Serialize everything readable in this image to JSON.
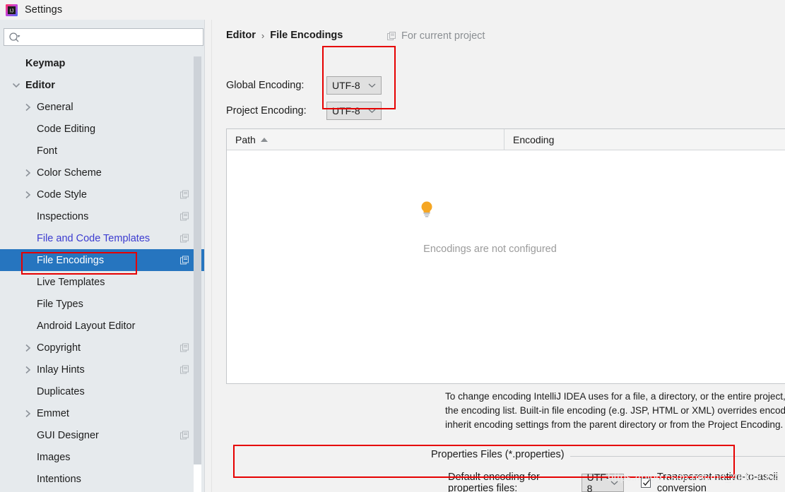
{
  "window": {
    "title": "Settings",
    "logo_icon": "intellij-idea-logo"
  },
  "sidebar": {
    "search": {
      "placeholder": "",
      "value": "",
      "icon": "search-icon"
    },
    "items": [
      {
        "label": "Keymap",
        "depth": 0,
        "twisty": "",
        "bold": true,
        "link": false,
        "copy": false,
        "selected": false
      },
      {
        "label": "Editor",
        "depth": 0,
        "twisty": "down",
        "bold": true,
        "link": false,
        "copy": false,
        "selected": false
      },
      {
        "label": "General",
        "depth": 1,
        "twisty": "right",
        "bold": false,
        "link": false,
        "copy": false,
        "selected": false
      },
      {
        "label": "Code Editing",
        "depth": 1,
        "twisty": "",
        "bold": false,
        "link": false,
        "copy": false,
        "selected": false
      },
      {
        "label": "Font",
        "depth": 1,
        "twisty": "",
        "bold": false,
        "link": false,
        "copy": false,
        "selected": false
      },
      {
        "label": "Color Scheme",
        "depth": 1,
        "twisty": "right",
        "bold": false,
        "link": false,
        "copy": false,
        "selected": false
      },
      {
        "label": "Code Style",
        "depth": 1,
        "twisty": "right",
        "bold": false,
        "link": false,
        "copy": true,
        "selected": false
      },
      {
        "label": "Inspections",
        "depth": 1,
        "twisty": "",
        "bold": false,
        "link": false,
        "copy": true,
        "selected": false
      },
      {
        "label": "File and Code Templates",
        "depth": 1,
        "twisty": "",
        "bold": false,
        "link": true,
        "copy": true,
        "selected": false
      },
      {
        "label": "File Encodings",
        "depth": 1,
        "twisty": "",
        "bold": false,
        "link": false,
        "copy": true,
        "selected": true
      },
      {
        "label": "Live Templates",
        "depth": 1,
        "twisty": "",
        "bold": false,
        "link": false,
        "copy": false,
        "selected": false
      },
      {
        "label": "File Types",
        "depth": 1,
        "twisty": "",
        "bold": false,
        "link": false,
        "copy": false,
        "selected": false
      },
      {
        "label": "Android Layout Editor",
        "depth": 1,
        "twisty": "",
        "bold": false,
        "link": false,
        "copy": false,
        "selected": false
      },
      {
        "label": "Copyright",
        "depth": 1,
        "twisty": "right",
        "bold": false,
        "link": false,
        "copy": true,
        "selected": false
      },
      {
        "label": "Inlay Hints",
        "depth": 1,
        "twisty": "right",
        "bold": false,
        "link": false,
        "copy": true,
        "selected": false
      },
      {
        "label": "Duplicates",
        "depth": 1,
        "twisty": "",
        "bold": false,
        "link": false,
        "copy": false,
        "selected": false
      },
      {
        "label": "Emmet",
        "depth": 1,
        "twisty": "right",
        "bold": false,
        "link": false,
        "copy": false,
        "selected": false
      },
      {
        "label": "GUI Designer",
        "depth": 1,
        "twisty": "",
        "bold": false,
        "link": false,
        "copy": true,
        "selected": false
      },
      {
        "label": "Images",
        "depth": 1,
        "twisty": "",
        "bold": false,
        "link": false,
        "copy": false,
        "selected": false
      },
      {
        "label": "Intentions",
        "depth": 1,
        "twisty": "",
        "bold": false,
        "link": false,
        "copy": false,
        "selected": false
      }
    ]
  },
  "main": {
    "breadcrumb": {
      "root": "Editor",
      "separator": "›",
      "current": "File Encodings"
    },
    "for_current_project": {
      "label": "For current project",
      "icon": "copy-settings-icon"
    },
    "global_encoding": {
      "label": "Global Encoding:",
      "value": "UTF-8"
    },
    "project_encoding": {
      "label": "Project Encoding:",
      "value": "UTF-8"
    },
    "table": {
      "columns": [
        "Path",
        "Encoding"
      ],
      "sort_column": "Path",
      "sort_direction": "asc",
      "rows": [],
      "empty_message": "Encodings are not configured",
      "empty_icon": "lightbulb-icon"
    },
    "description": [
      "To change encoding IntelliJ IDEA uses for a file, a directory, or the entire project, add its path if necessary and then select encoding from",
      "the encoding list. Built-in file encoding (e.g. JSP, HTML or XML) overrides encoding you specify here. If not specified, files and directories",
      "inherit encoding settings from the parent directory or from the Project Encoding."
    ],
    "properties_group": {
      "title": "Properties Files (*.properties)",
      "default_encoding_label": "Default encoding for properties files:",
      "default_encoding_value": "UTF-8",
      "transparent_label": "Transparent native-to-ascii conversion",
      "transparent_checked": true
    }
  },
  "watermark": {
    "text": "https://blog.csdn.net/m0_46132054"
  },
  "colors": {
    "selection_blue": "#2675bf",
    "annotation_red": "#e60000",
    "link_purple": "#3b3bd0",
    "sidebar_bg": "#e6eaed",
    "panel_bg": "#f2f2f2",
    "bulb_yellow": "#f5a623"
  }
}
